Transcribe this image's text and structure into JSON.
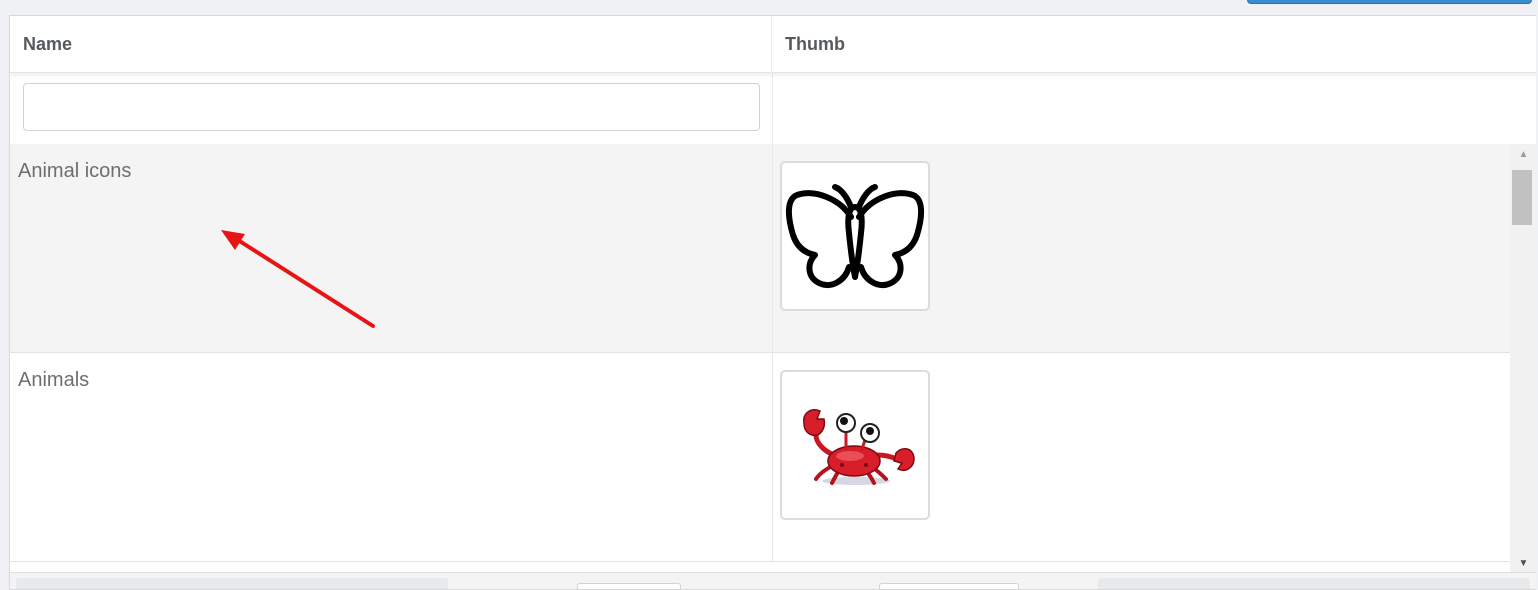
{
  "grid": {
    "columns": [
      {
        "label": "Name"
      },
      {
        "label": "Thumb"
      }
    ],
    "filter": {
      "name_value": "",
      "name_placeholder": ""
    },
    "rows": [
      {
        "name": "Animal icons",
        "thumb_icon": "butterfly-outline-icon"
      },
      {
        "name": "Animals",
        "thumb_icon": "red-crab-cartoon"
      }
    ]
  },
  "scrollbar": {
    "up_glyph": "▲",
    "down_glyph": "▼"
  },
  "colors": {
    "annotation_arrow": "#e81313",
    "top_button": "#3a8ccc",
    "alt_row": "#f4f4f4"
  }
}
